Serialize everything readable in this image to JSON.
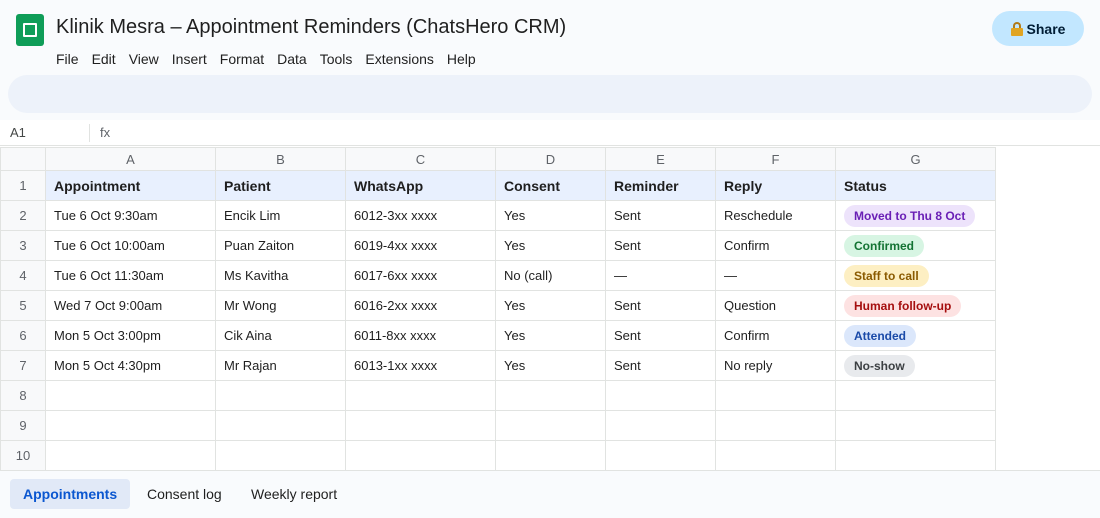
{
  "app": {
    "title": "Klinik Mesra – Appointment Reminders (ChatsHero CRM)",
    "share_label": "Share",
    "menu": [
      "File",
      "Edit",
      "View",
      "Insert",
      "Format",
      "Data",
      "Tools",
      "Extensions",
      "Help"
    ]
  },
  "formula_bar": {
    "cell_ref": "A1",
    "fx_label": "fx"
  },
  "grid": {
    "column_letters": [
      "A",
      "B",
      "C",
      "D",
      "E",
      "F",
      "G"
    ],
    "row_numbers": [
      "1",
      "2",
      "3",
      "4",
      "5",
      "6",
      "7",
      "8",
      "9",
      "10"
    ],
    "headers": [
      "Appointment",
      "Patient",
      "WhatsApp",
      "Consent",
      "Reminder",
      "Reply",
      "Status"
    ],
    "rows": [
      {
        "appointment": "Tue 6 Oct 9:30am",
        "patient": "Encik Lim",
        "whatsapp": "6012-3xx xxxx",
        "consent": "Yes",
        "reminder": "Sent",
        "reply": "Reschedule",
        "status": "Moved to Thu 8 Oct",
        "status_bg": "#ede3fb",
        "status_fg": "#6a1fb5"
      },
      {
        "appointment": "Tue 6 Oct 10:00am",
        "patient": "Puan Zaiton",
        "whatsapp": "6019-4xx xxxx",
        "consent": "Yes",
        "reminder": "Sent",
        "reply": "Confirm",
        "status": "Confirmed",
        "status_bg": "#d7f5e3",
        "status_fg": "#137333"
      },
      {
        "appointment": "Tue 6 Oct 11:30am",
        "patient": "Ms Kavitha",
        "whatsapp": "6017-6xx xxxx",
        "consent": "No (call)",
        "reminder": "—",
        "reply": "—",
        "status": "Staff to call",
        "status_bg": "#fdefc3",
        "status_fg": "#8a5a00"
      },
      {
        "appointment": "Wed 7 Oct 9:00am",
        "patient": "Mr Wong",
        "whatsapp": "6016-2xx xxxx",
        "consent": "Yes",
        "reminder": "Sent",
        "reply": "Question",
        "status": "Human follow-up",
        "status_bg": "#fde2e2",
        "status_fg": "#a50e0e"
      },
      {
        "appointment": "Mon 5 Oct 3:00pm",
        "patient": "Cik Aina",
        "whatsapp": "6011-8xx xxxx",
        "consent": "Yes",
        "reminder": "Sent",
        "reply": "Confirm",
        "status": "Attended",
        "status_bg": "#dbe7fb",
        "status_fg": "#1a4aa8"
      },
      {
        "appointment": "Mon 5 Oct 4:30pm",
        "patient": "Mr Rajan",
        "whatsapp": "6013-1xx xxxx",
        "consent": "Yes",
        "reminder": "Sent",
        "reply": "No reply",
        "status": "No-show",
        "status_bg": "#e8eaed",
        "status_fg": "#3c4043"
      }
    ]
  },
  "sheets": [
    {
      "label": "Appointments",
      "active": true
    },
    {
      "label": "Consent log",
      "active": false
    },
    {
      "label": "Weekly report",
      "active": false
    }
  ]
}
